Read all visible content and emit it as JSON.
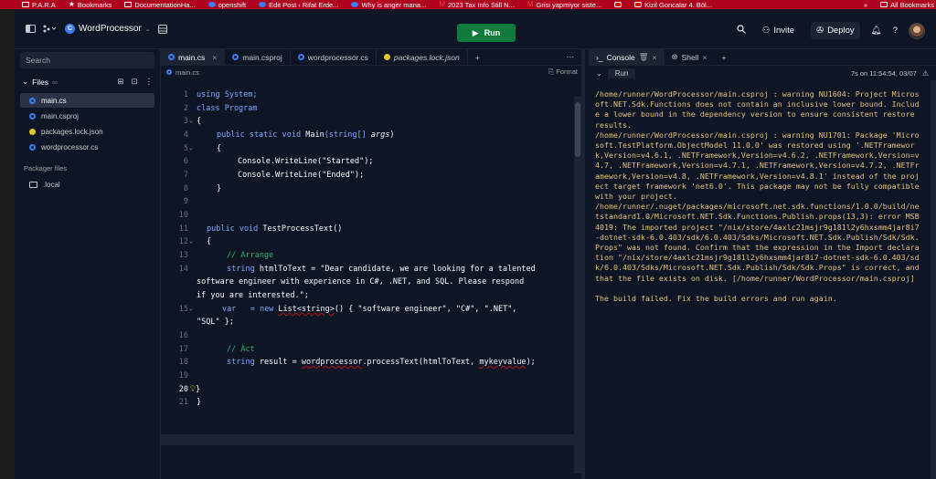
{
  "bookmarks": [
    {
      "label": "P.A.R.A",
      "icon": "folder-icon"
    },
    {
      "label": "Bookmarks",
      "icon": "star-icon"
    },
    {
      "label": "DocumentationHa...",
      "icon": "folder-icon"
    },
    {
      "label": "openshift",
      "icon": "globe-icon"
    },
    {
      "label": "Edit Post ‹ Rifat Erde...",
      "icon": "globe-icon"
    },
    {
      "label": "Why is anger mana...",
      "icon": "globe-icon"
    },
    {
      "label": "2023 Tax Info Still N...",
      "icon": "gmail-icon"
    },
    {
      "label": "Grisi yapmiyor siste...",
      "icon": "gmail-icon"
    },
    {
      "label": "",
      "icon": "youtube-icon"
    },
    {
      "label": "Kizil Goncalar 4. Böl...",
      "icon": "youtube-icon"
    }
  ],
  "bookmarks_more": "»",
  "bookmarks_all": "All Bookmarks",
  "header": {
    "repl_name": "WordProcessor",
    "run_label": "Run",
    "invite_label": "Invite",
    "deploy_label": "Deploy"
  },
  "sidebar": {
    "search_placeholder": "Search",
    "files_label": "Files",
    "files": [
      {
        "name": "main.cs",
        "type": "cs",
        "active": true
      },
      {
        "name": "main.csproj",
        "type": "cs",
        "active": false
      },
      {
        "name": "packages.lock.json",
        "type": "json",
        "active": false
      },
      {
        "name": "wordprocessor.cs",
        "type": "cs",
        "active": false
      }
    ],
    "packager_label": "Packager files",
    "packager_files": [
      {
        "name": ".local",
        "type": "folder"
      }
    ]
  },
  "editor": {
    "tabs": [
      {
        "label": "main.cs",
        "active": true,
        "closable": true
      },
      {
        "label": "main.csproj",
        "active": false,
        "closable": false
      },
      {
        "label": "wordprocessor.cs",
        "active": false,
        "closable": false
      },
      {
        "label": "packages.lock.json",
        "active": false,
        "closable": false
      }
    ],
    "path": "main.cs",
    "format_label": "Format",
    "current_line": 20
  },
  "console": {
    "tabs": [
      {
        "label": "Console",
        "active": true
      },
      {
        "label": "Shell",
        "active": false
      }
    ],
    "run_chip": "Run",
    "timestamp": "7s on 11:54:54, 03/07",
    "output": "/home/runner/WordProcessor/main.csproj : warning NU1604: Project Microsoft.NET.Sdk.Functions does not contain an inclusive lower bound. Include a lower bound in the dependency version to ensure consistent restore results.\n/home/runner/WordProcessor/main.csproj : warning NU1701: Package 'Microsoft.TestPlatform.ObjectModel 11.0.0' was restored using '.NETFramework,Version=v4.6.1, .NETFramework,Version=v4.6.2, .NETFramework,Version=v4.7, .NETFramework,Version=v4.7.1, .NETFramework,Version=v4.7.2, .NETFramework,Version=v4.8, .NETFramework,Version=v4.8.1' instead of the project target framework 'net6.0'. This package may not be fully compatible with your project.\n/home/runner/.nuget/packages/microsoft.net.sdk.functions/1.0.0/build/netstandard1.0/Microsoft.NET.Sdk.Functions.Publish.props(13,3): error MSB4019: The imported project \"/nix/store/4axlc21msjr9g181l2y6hxsmm4jar8i7-dotnet-sdk-6.0.403/sdk/6.0.403/Sdks/Microsoft.NET.Sdk.Publish/Sdk/Sdk.Props\" was not found. Confirm that the expression in the Import declaration \"/nix/store/4axlc21msjr9g181l2y6hxsmm4jar8i7-dotnet-sdk-6.0.403/sdk/6.0.403/Sdks/Microsoft.NET.Sdk.Publish/Sdk/Sdk.Props\" is correct, and that the file exists on disk. [/home/runner/WordProcessor/main.csproj]\n\nThe build failed. Fix the build errors and run again."
  },
  "code": {
    "l1": "using System;",
    "l2": "class Program",
    "l3": "{",
    "l4a": "public static void ",
    "l4b": "Main",
    "l4c": "(string[] ",
    "l4d": "args",
    "l4e": ")",
    "l5": "{",
    "l6a": "Console.",
    "l6b": "WriteLine",
    "l6c": "(\"Started\");",
    "l7a": "Console.",
    "l7b": "WriteLine",
    "l7c": "(\"Ended\");",
    "l8": "}",
    "l11a": "public void ",
    "l11b": "TestProcessText",
    "l11c": "()",
    "l12": "{",
    "l13": "// Arrange",
    "l14a": "string ",
    "l14b": "htmlToText",
    "l14c": " = \"Dear candidate, we are looking for a talented",
    "l14d": "software engineer with experience in C#, .NET, and SQL. Please respond",
    "l14e": "if you are interested.\";",
    "l15a": "var",
    "l15b": "   = new ",
    "l15c": "List<string>",
    "l15d": "() { \"software engineer\", \"C#\", \".NET\",",
    "l15e": "\"SQL\" };",
    "l17": "// Act",
    "l18a": "string ",
    "l18b": "result",
    "l18c": " = ",
    "l18d": "wordprocessor",
    "l18e": ".processText(htmlToText, ",
    "l18f": "mykeyvalue",
    "l18g": ");",
    "l20": "}",
    "l21": "}"
  }
}
